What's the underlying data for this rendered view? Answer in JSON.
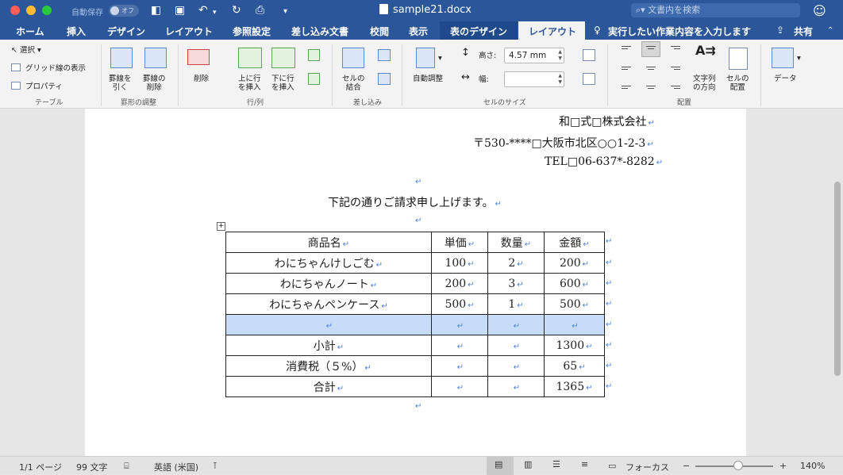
{
  "titlebar": {
    "autosave_label": "自動保存",
    "autosave_state": "オフ",
    "doc_title": "sample21.docx",
    "search_placeholder": "文書内を検索"
  },
  "tabs": [
    {
      "label": "ホーム"
    },
    {
      "label": "挿入"
    },
    {
      "label": "デザイン"
    },
    {
      "label": "レイアウト"
    },
    {
      "label": "参照設定"
    },
    {
      "label": "差し込み文書"
    },
    {
      "label": "校閲"
    },
    {
      "label": "表示"
    },
    {
      "label": "表のデザイン"
    },
    {
      "label": "レイアウト"
    }
  ],
  "tellme": "実行したい作業内容を入力します",
  "share": "共有",
  "ribbon": {
    "select": "選択",
    "gridlines": "グリッド線の表示",
    "properties": "プロパティ",
    "group_table": "テーブル",
    "draw_border_1": "罫線を",
    "draw_border_2": "引く",
    "erase_border_1": "罫線の",
    "erase_border_2": "削除",
    "group_draw": "罫形の調整",
    "delete": "削除",
    "insert_above_1": "上に行",
    "insert_above_2": "を挿入",
    "insert_below_1": "下に行",
    "insert_below_2": "を挿入",
    "group_rowcol": "行/列",
    "merge_1": "セルの",
    "merge_2": "結合",
    "group_merge": "差し込み",
    "autofit": "自動調整",
    "height_label": "高さ:",
    "height_value": "4.57 mm",
    "width_label": "幅:",
    "width_value": "",
    "group_cellsize": "セルのサイズ",
    "text_dir_1": "文字列",
    "text_dir_2": "の方向",
    "cell_margin_1": "セルの",
    "cell_margin_2": "配置",
    "group_align": "配置",
    "data": "データ"
  },
  "document": {
    "company": "和□式□株式会社",
    "address": "〒530-****□大阪市北区○○1-2-3",
    "tel": "TEL□06-637*-8282",
    "intro": "下記の通りご請求申し上げます。",
    "table": {
      "headers": [
        "商品名",
        "単価",
        "数量",
        "金額"
      ],
      "rows": [
        [
          "わにちゃんけしごむ",
          "100",
          "2",
          "200"
        ],
        [
          "わにちゃんノート",
          "200",
          "3",
          "600"
        ],
        [
          "わにちゃんペンケース",
          "500",
          "1",
          "500"
        ],
        [
          "",
          "",
          "",
          ""
        ],
        [
          "小計",
          "",
          "",
          "1300"
        ],
        [
          "消費税（５%）",
          "",
          "",
          "65"
        ],
        [
          "合計",
          "",
          "",
          "1365"
        ]
      ]
    }
  },
  "status": {
    "page": "1/1 ページ",
    "words": "99 文字",
    "language": "英語 (米国)",
    "focus": "フォーカス",
    "zoom": "140%"
  }
}
